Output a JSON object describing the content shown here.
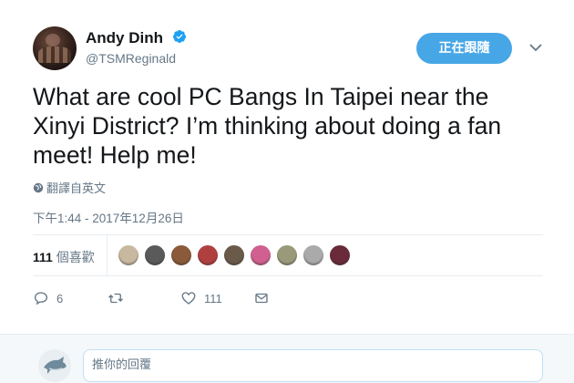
{
  "user": {
    "name": "Andy Dinh",
    "handle": "@TSMReginald",
    "follow_label": "正在跟隨"
  },
  "tweet": {
    "text": "What are cool PC Bangs In Taipei near the Xinyi District? I’m thinking about doing a fan meet! Help me!",
    "translate_label": "翻譯自英文",
    "timestamp": "下午1:44 - 2017年12月26日"
  },
  "stats": {
    "likes_count": "111",
    "likes_label": "個喜歡"
  },
  "likers": [
    {
      "icon": "liker-avatar",
      "color": "#c9b8a0"
    },
    {
      "icon": "liker-avatar",
      "color": "#5a5a5a"
    },
    {
      "icon": "liker-avatar",
      "color": "#8a5a3a"
    },
    {
      "icon": "liker-avatar",
      "color": "#b04040"
    },
    {
      "icon": "liker-avatar",
      "color": "#6a5a4a"
    },
    {
      "icon": "liker-avatar",
      "color": "#d06090"
    },
    {
      "icon": "liker-avatar",
      "color": "#9a9a7a"
    },
    {
      "icon": "liker-avatar",
      "color": "#aaaaaa"
    },
    {
      "icon": "liker-avatar",
      "color": "#6a2a3a"
    }
  ],
  "actions": {
    "reply_count": "6",
    "retweet_count": "",
    "like_count": "111"
  },
  "reply": {
    "placeholder": "推你的回覆"
  },
  "colors": {
    "accent": "#47a6e6",
    "muted": "#657786",
    "text": "#14171a"
  }
}
